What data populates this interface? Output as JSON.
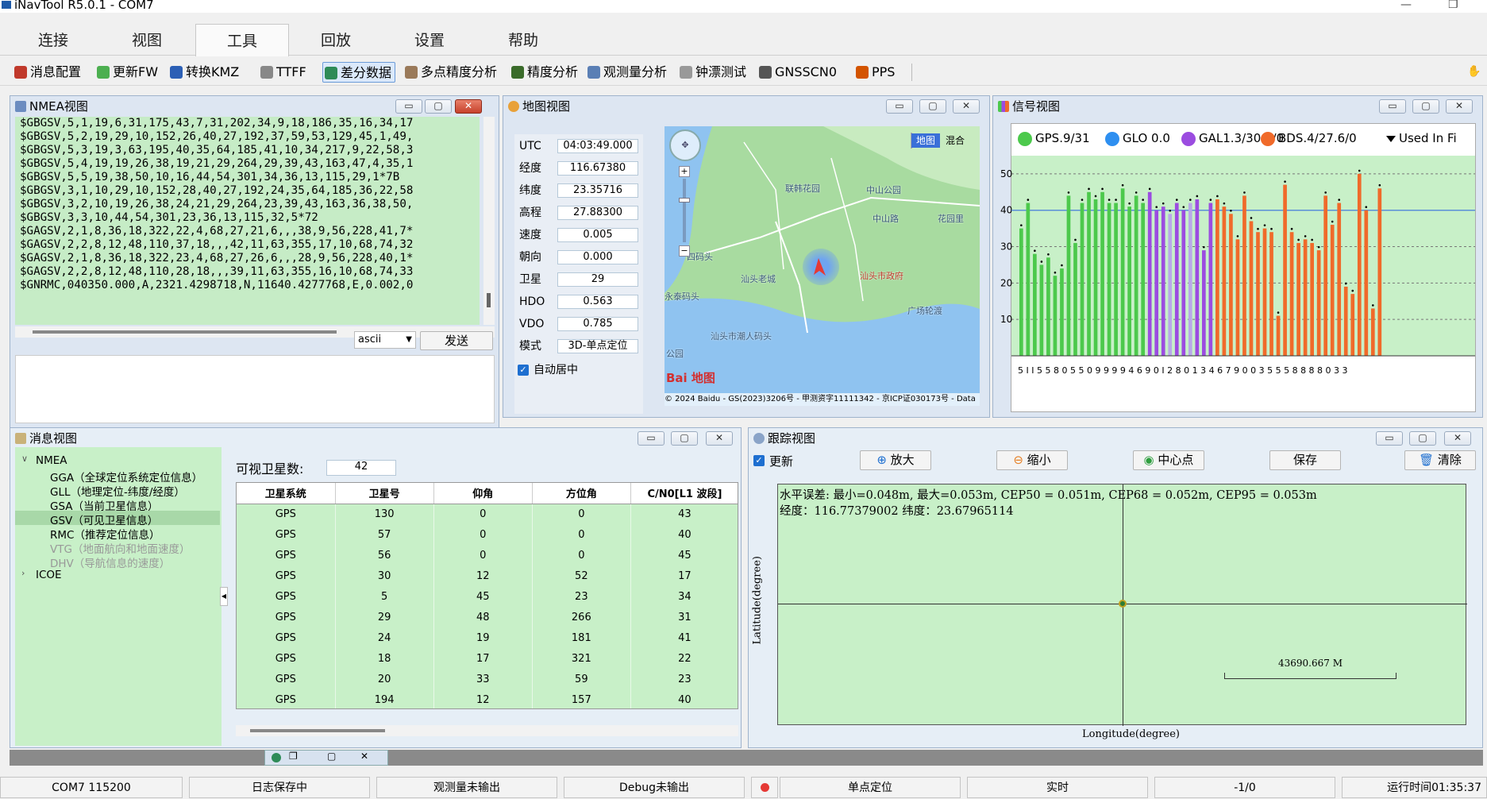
{
  "app": {
    "title": "iNavTool R5.0.1 - COM7"
  },
  "menu": {
    "tabs": [
      "连接",
      "视图",
      "工具",
      "回放",
      "设置",
      "帮助"
    ],
    "active": 2
  },
  "toolbar": {
    "items": [
      {
        "label": "消息配置",
        "icon": "message-config-icon",
        "color": "#c0392b"
      },
      {
        "label": "更新FW",
        "icon": "update-fw-icon",
        "color": "#4caf50"
      },
      {
        "label": "转换KMZ",
        "icon": "convert-kmz-icon",
        "color": "#2b5fb5"
      },
      {
        "label": "TTFF",
        "icon": "ttff-icon",
        "color": "#888"
      },
      {
        "label": "差分数据",
        "icon": "diff-data-icon",
        "color": "#2e8b57"
      },
      {
        "label": "多点精度分析",
        "icon": "multipoint-accuracy-icon",
        "color": "#9a7a5a"
      },
      {
        "label": "精度分析",
        "icon": "accuracy-analysis-icon",
        "color": "#3a6b2a"
      },
      {
        "label": "观测量分析",
        "icon": "observation-analysis-icon",
        "color": "#5a7fb5"
      },
      {
        "label": "钟漂测试",
        "icon": "clock-drift-icon",
        "color": "#999"
      },
      {
        "label": "GNSSCN0",
        "icon": "gnsscn0-icon",
        "color": "#555"
      },
      {
        "label": "PPS",
        "icon": "pps-icon",
        "color": "#d35400"
      }
    ]
  },
  "nmea_view": {
    "title": "NMEA视图",
    "lines": [
      "$GBGSV,5,1,19,6,31,175,43,7,31,202,34,9,18,186,35,16,34,17",
      "$GBGSV,5,2,19,29,10,152,26,40,27,192,37,59,53,129,45,1,49,",
      "$GBGSV,5,3,19,3,63,195,40,35,64,185,41,10,34,217,9,22,58,3",
      "$GBGSV,5,4,19,19,26,38,19,21,29,264,29,39,43,163,47,4,35,1",
      "$GBGSV,5,5,19,38,50,10,16,44,54,301,34,36,13,115,29,1*7B",
      "$GBGSV,3,1,10,29,10,152,28,40,27,192,24,35,64,185,36,22,58",
      "$GBGSV,3,2,10,19,26,38,24,21,29,264,23,39,43,163,36,38,50,",
      "$GBGSV,3,3,10,44,54,301,23,36,13,115,32,5*72",
      "$GAGSV,2,1,8,36,18,322,22,4,68,27,21,6,,,38,9,56,228,41,7*",
      "$GAGSV,2,2,8,12,48,110,37,18,,,42,11,63,355,17,10,68,74,32",
      "$GAGSV,2,1,8,36,18,322,23,4,68,27,26,6,,,28,9,56,228,40,1*",
      "$GAGSV,2,2,8,12,48,110,28,18,,,39,11,63,355,16,10,68,74,33",
      "$GNRMC,040350.000,A,2321.4298718,N,11640.4277768,E,0.002,0"
    ],
    "encoding": "ascii",
    "send_label": "发送"
  },
  "map_view": {
    "title": "地图视图",
    "rows": [
      {
        "label": "UTC",
        "value": "04:03:49.000"
      },
      {
        "label": "经度",
        "value": "116.67380"
      },
      {
        "label": "纬度",
        "value": "23.35716"
      },
      {
        "label": "高程",
        "value": "27.88300"
      },
      {
        "label": "速度",
        "value": "0.005"
      },
      {
        "label": "朝向",
        "value": "0.000"
      },
      {
        "label": "卫星",
        "value": "29"
      },
      {
        "label": "HDO",
        "value": "0.563"
      },
      {
        "label": "VDO",
        "value": "0.785"
      },
      {
        "label": "模式",
        "value": "3D-单点定位"
      }
    ],
    "auto_center": "自动居中",
    "map_modes": [
      "地图",
      "混合"
    ],
    "places": [
      "联韩花园",
      "中山公园",
      "中山路",
      "花园里",
      "四码头",
      "汕头老城",
      "汕头市政府",
      "永泰码头",
      "广场轮渡",
      "汕头市潮人码头",
      "公园"
    ],
    "copyright": "© 2024 Baidu - GS(2023)3206号 - 甲测资字11111342 - 京ICP证030173号 - Data",
    "logo": "Bai 地图"
  },
  "signal_view": {
    "title": "信号视图",
    "legend": [
      {
        "label": "GPS.9/31",
        "color": "#4cc94c"
      },
      {
        "label": "GLO 0.0",
        "color": "#2e8ff0"
      },
      {
        "label": "GAL1.3/30.1/0",
        "color": "#9b4ce0"
      },
      {
        "label": "BDS.4/27.6/0",
        "color": "#f06a2a"
      },
      {
        "label": "Used In Fi",
        "color": "#000"
      }
    ],
    "yticks": [
      10,
      20,
      30,
      40,
      50
    ],
    "ylim": [
      0,
      55
    ],
    "reference_level": 40,
    "xlabel_text": "5 I I 5 5 8 0 5 5 0 9 9 9 9 4 6 9 0 I 2 8 0 1 3 4 6 7 9 0 0 3 5 5 5 8 8 8 8 0 3 3",
    "bars": [
      {
        "v": 35,
        "c": "#4cc94c"
      },
      {
        "v": 42,
        "c": "#4cc94c"
      },
      {
        "v": 28,
        "c": "#4cc94c"
      },
      {
        "v": 25,
        "c": "#4cc94c"
      },
      {
        "v": 27,
        "c": "#4cc94c"
      },
      {
        "v": 22,
        "c": "#4cc94c"
      },
      {
        "v": 24,
        "c": "#4cc94c"
      },
      {
        "v": 44,
        "c": "#4cc94c"
      },
      {
        "v": 31,
        "c": "#4cc94c"
      },
      {
        "v": 42,
        "c": "#4cc94c"
      },
      {
        "v": 45,
        "c": "#4cc94c"
      },
      {
        "v": 43,
        "c": "#4cc94c"
      },
      {
        "v": 45,
        "c": "#4cc94c"
      },
      {
        "v": 42,
        "c": "#4cc94c"
      },
      {
        "v": 42,
        "c": "#4cc94c"
      },
      {
        "v": 46,
        "c": "#4cc94c"
      },
      {
        "v": 41,
        "c": "#4cc94c"
      },
      {
        "v": 44,
        "c": "#4cc94c"
      },
      {
        "v": 42,
        "c": "#4cc94c"
      },
      {
        "v": 45,
        "c": "#9b4ce0"
      },
      {
        "v": 40,
        "c": "#9b4ce0"
      },
      {
        "v": 41,
        "c": "#9b4ce0"
      },
      {
        "v": 39,
        "c": "#b8a8e8"
      },
      {
        "v": 42,
        "c": "#9b4ce0"
      },
      {
        "v": 40,
        "c": "#9b4ce0"
      },
      {
        "v": 42,
        "c": "#b8a8e8"
      },
      {
        "v": 43,
        "c": "#9b4ce0"
      },
      {
        "v": 29,
        "c": "#9b4ce0"
      },
      {
        "v": 42,
        "c": "#9b4ce0"
      },
      {
        "v": 43,
        "c": "#f06a2a"
      },
      {
        "v": 41,
        "c": "#f06a2a"
      },
      {
        "v": 39,
        "c": "#f06a2a"
      },
      {
        "v": 32,
        "c": "#f06a2a"
      },
      {
        "v": 44,
        "c": "#f06a2a"
      },
      {
        "v": 37,
        "c": "#f06a2a"
      },
      {
        "v": 34,
        "c": "#f06a2a"
      },
      {
        "v": 35,
        "c": "#f06a2a"
      },
      {
        "v": 34,
        "c": "#f06a2a"
      },
      {
        "v": 11,
        "c": "#f06a2a"
      },
      {
        "v": 47,
        "c": "#f06a2a"
      },
      {
        "v": 34,
        "c": "#f06a2a"
      },
      {
        "v": 31,
        "c": "#f06a2a"
      },
      {
        "v": 32,
        "c": "#f06a2a"
      },
      {
        "v": 31,
        "c": "#f06a2a"
      },
      {
        "v": 29,
        "c": "#f06a2a"
      },
      {
        "v": 44,
        "c": "#f06a2a"
      },
      {
        "v": 36,
        "c": "#f06a2a"
      },
      {
        "v": 42,
        "c": "#f06a2a"
      },
      {
        "v": 19,
        "c": "#f06a2a"
      },
      {
        "v": 17,
        "c": "#f06a2a"
      },
      {
        "v": 50,
        "c": "#f06a2a"
      },
      {
        "v": 40,
        "c": "#f06a2a"
      },
      {
        "v": 13,
        "c": "#f06a2a"
      },
      {
        "v": 46,
        "c": "#f06a2a"
      }
    ]
  },
  "message_view": {
    "title": "消息视图",
    "tree": [
      {
        "label": "NMEA",
        "level": 0,
        "expanded": true
      },
      {
        "label": "GGA（全球定位系统定位信息）",
        "level": 1
      },
      {
        "label": "GLL（地理定位-纬度/经度）",
        "level": 1
      },
      {
        "label": "GSA（当前卫星信息）",
        "level": 1
      },
      {
        "label": "GSV（可见卫星信息）",
        "level": 1,
        "selected": true
      },
      {
        "label": "RMC（推荐定位信息）",
        "level": 1
      },
      {
        "label": "VTG（地面航向和地面速度）",
        "level": 1,
        "disabled": true
      },
      {
        "label": "DHV（导航信息的速度）",
        "level": 1,
        "disabled": true
      },
      {
        "label": "ICOE",
        "level": 0,
        "expanded": false
      }
    ],
    "visible_label": "可视卫星数:",
    "visible_count": "42",
    "columns": [
      "卫星系统",
      "卫星号",
      "仰角",
      "方位角",
      "C/N0[L1 波段]"
    ],
    "rows": [
      [
        "GPS",
        "130",
        "0",
        "0",
        "43"
      ],
      [
        "GPS",
        "57",
        "0",
        "0",
        "40"
      ],
      [
        "GPS",
        "56",
        "0",
        "0",
        "45"
      ],
      [
        "GPS",
        "30",
        "12",
        "52",
        "17"
      ],
      [
        "GPS",
        "5",
        "45",
        "23",
        "34"
      ],
      [
        "GPS",
        "29",
        "48",
        "266",
        "31"
      ],
      [
        "GPS",
        "24",
        "19",
        "181",
        "41"
      ],
      [
        "GPS",
        "18",
        "17",
        "321",
        "22"
      ],
      [
        "GPS",
        "20",
        "33",
        "59",
        "23"
      ],
      [
        "GPS",
        "194",
        "12",
        "157",
        "40"
      ]
    ]
  },
  "track_view": {
    "title": "跟踪视图",
    "update_label": "更新",
    "zoom_in": "放大",
    "zoom_out": "缩小",
    "center": "中心点",
    "save": "保存",
    "clear": "清除",
    "stats_line1": "水平误差: 最小=0.048m, 最大=0.053m, CEP50 = 0.051m, CEP68 = 0.052m, CEP95 = 0.053m",
    "stats_line2": "经度：116.77379002 纬度：23.67965114",
    "scale_label": "43690.667 M",
    "xlabel": "Longitude(degree)",
    "ylabel": "Latitude(degree)"
  },
  "status": {
    "port": "COM7 115200",
    "log": "日志保存中",
    "obs": "观测量未输出",
    "debug": "Debug未输出",
    "mode": "单点定位",
    "realtime": "实时",
    "counter": "-1/0",
    "runtime": "运行时间01:35:37"
  }
}
